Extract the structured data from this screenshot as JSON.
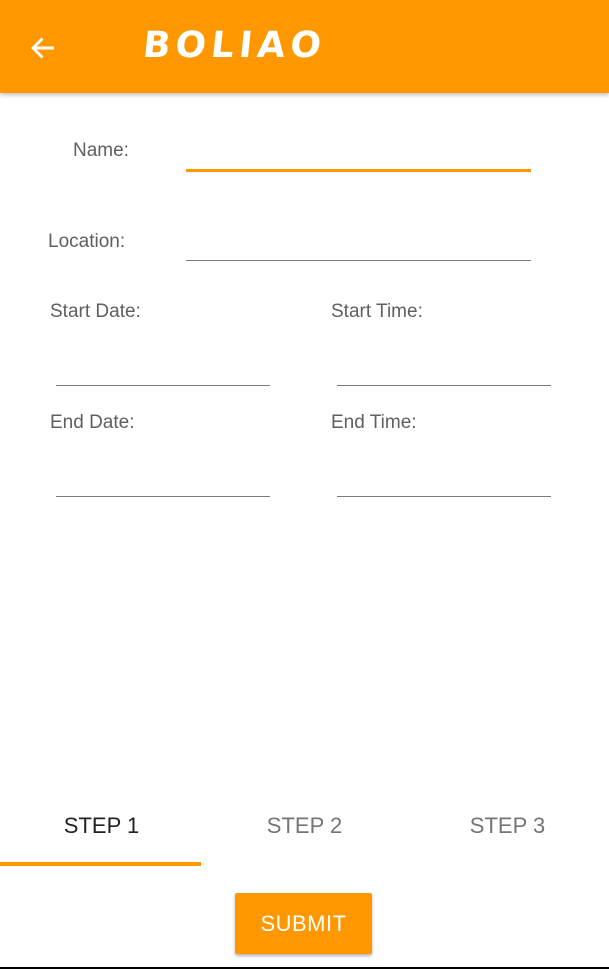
{
  "appbar": {
    "title": "BOLIAO",
    "back_icon": "arrow-left-icon",
    "background_color": "#ff9800"
  },
  "form": {
    "name_label": "Name:",
    "name_value": "",
    "location_label": "Location:",
    "location_value": "",
    "start_date_label": "Start Date:",
    "start_date_value": "",
    "start_time_label": "Start Time:",
    "start_time_value": "",
    "end_date_label": "End Date:",
    "end_date_value": "",
    "end_time_label": "End Time:",
    "end_time_value": ""
  },
  "tabs": [
    {
      "label": "STEP 1",
      "active": true
    },
    {
      "label": "STEP 2",
      "active": false
    },
    {
      "label": "STEP 3",
      "active": false
    }
  ],
  "submit_label": "SUBMIT",
  "accent_color": "#ff9800"
}
